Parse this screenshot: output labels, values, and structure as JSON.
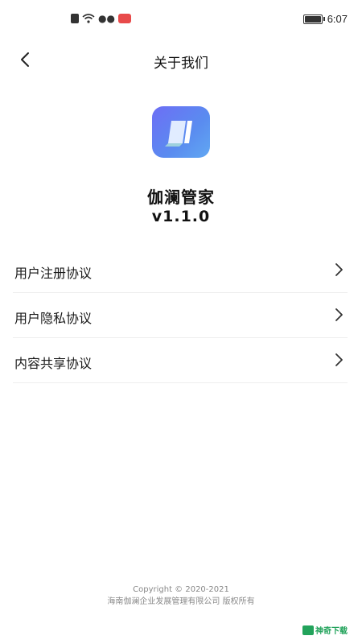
{
  "status_bar": {
    "time": "6:07",
    "icons": [
      "sim-icon",
      "wifi-icon",
      "chat-icon",
      "red-app-icon",
      "battery-icon"
    ]
  },
  "nav": {
    "title": "关于我们",
    "back_icon": "chevron-left-icon"
  },
  "app": {
    "name": "伽澜管家",
    "version": "v1.1.0",
    "logo_colors": [
      "#6d6ef5",
      "#61a8f2"
    ]
  },
  "menu": {
    "items": [
      {
        "label": "用户注册协议",
        "icon": "chevron-right-icon"
      },
      {
        "label": "用户隐私协议",
        "icon": "chevron-right-icon"
      },
      {
        "label": "内容共享协议",
        "icon": "chevron-right-icon"
      }
    ]
  },
  "footer": {
    "copyright": "Copyright © 2020-2021",
    "company": "海南伽澜企业发展管理有限公司 版权所有"
  },
  "watermark": {
    "text": "神奇下载",
    "color": "#22a35b"
  }
}
